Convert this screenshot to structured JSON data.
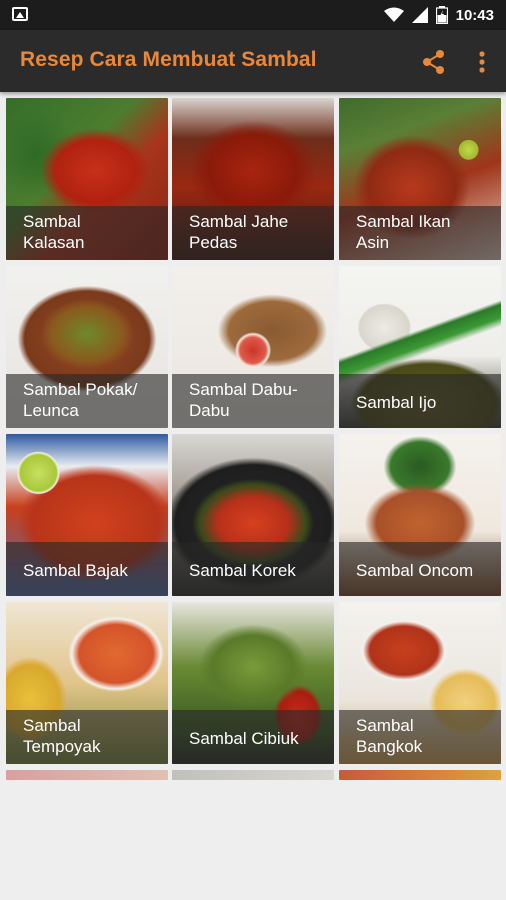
{
  "status_bar": {
    "time": "10:43"
  },
  "app_bar": {
    "title": "Resep Cara Membuat Sambal",
    "accent_color": "#e8883a",
    "actions": [
      "share-icon",
      "more-vert-icon"
    ]
  },
  "recipes": [
    {
      "label": "Sambal\nKalasan"
    },
    {
      "label": "Sambal Jahe\nPedas"
    },
    {
      "label": "Sambal Ikan\nAsin"
    },
    {
      "label": "Sambal Pokak/\nLeunca"
    },
    {
      "label": "Sambal Dabu-\nDabu"
    },
    {
      "label": "Sambal Ijo"
    },
    {
      "label": "Sambal Bajak"
    },
    {
      "label": "Sambal Korek"
    },
    {
      "label": "Sambal Oncom"
    },
    {
      "label": "Sambal\nTempoyak"
    },
    {
      "label": "Sambal Cibiuk"
    },
    {
      "label": "Sambal\nBangkok"
    }
  ]
}
